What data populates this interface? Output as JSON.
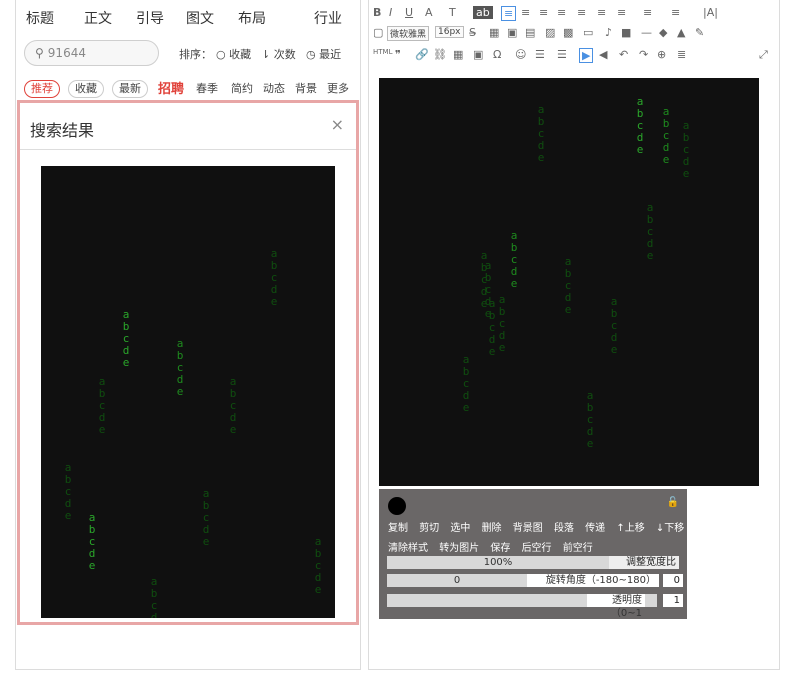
{
  "left": {
    "nav": [
      "标题",
      "正文",
      "引导",
      "图文",
      "布局",
      "行业"
    ],
    "search": {
      "value": "91644"
    },
    "sort": {
      "label": "排序：",
      "option_active": "收藏",
      "option_count": "次数",
      "option_recent": "最近"
    },
    "tabs": [
      "推荐",
      "收藏",
      "最新"
    ],
    "cats": [
      "招聘",
      "春季",
      "简约",
      "动态",
      "背景",
      "更多"
    ],
    "results_title": "搜索结果",
    "close": "×"
  },
  "glyph_col": [
    "a",
    "b",
    "c",
    "d",
    "e"
  ],
  "right": {
    "toolbar": {
      "row1": [
        "B",
        "I",
        "U",
        "A",
        "T",
        "ab",
        "≡",
        "≡",
        "≡",
        "≡",
        "≡",
        "≡",
        "≡",
        "≡",
        "≡",
        "|A|"
      ],
      "row2_font": "微软雅黑",
      "row2_size": "16px",
      "row3": [
        "HTML",
        "❞",
        "🔗",
        "⛓",
        "▦",
        "▣",
        "Ω",
        "☺",
        "☰",
        "☰",
        "▶",
        "◀",
        "↶",
        "↷",
        "⊕",
        "≣",
        "⤢"
      ]
    },
    "popup": {
      "actions1": [
        "复制",
        "剪切",
        "选中",
        "删除",
        "背景图",
        "段落",
        "传递",
        "↑上移",
        "↓下移"
      ],
      "actions2": [
        "清除样式",
        "转为图片",
        "保存",
        "后空行",
        "前空行"
      ],
      "width_pct": "100%",
      "width_label": "调整宽度比",
      "rotate_value": "0",
      "rotate_label": "旋转角度（-180~180）",
      "rotate_num": "0",
      "opacity_label": "透明度（0~1",
      "opacity_num": "1",
      "lock": "🔓"
    }
  }
}
